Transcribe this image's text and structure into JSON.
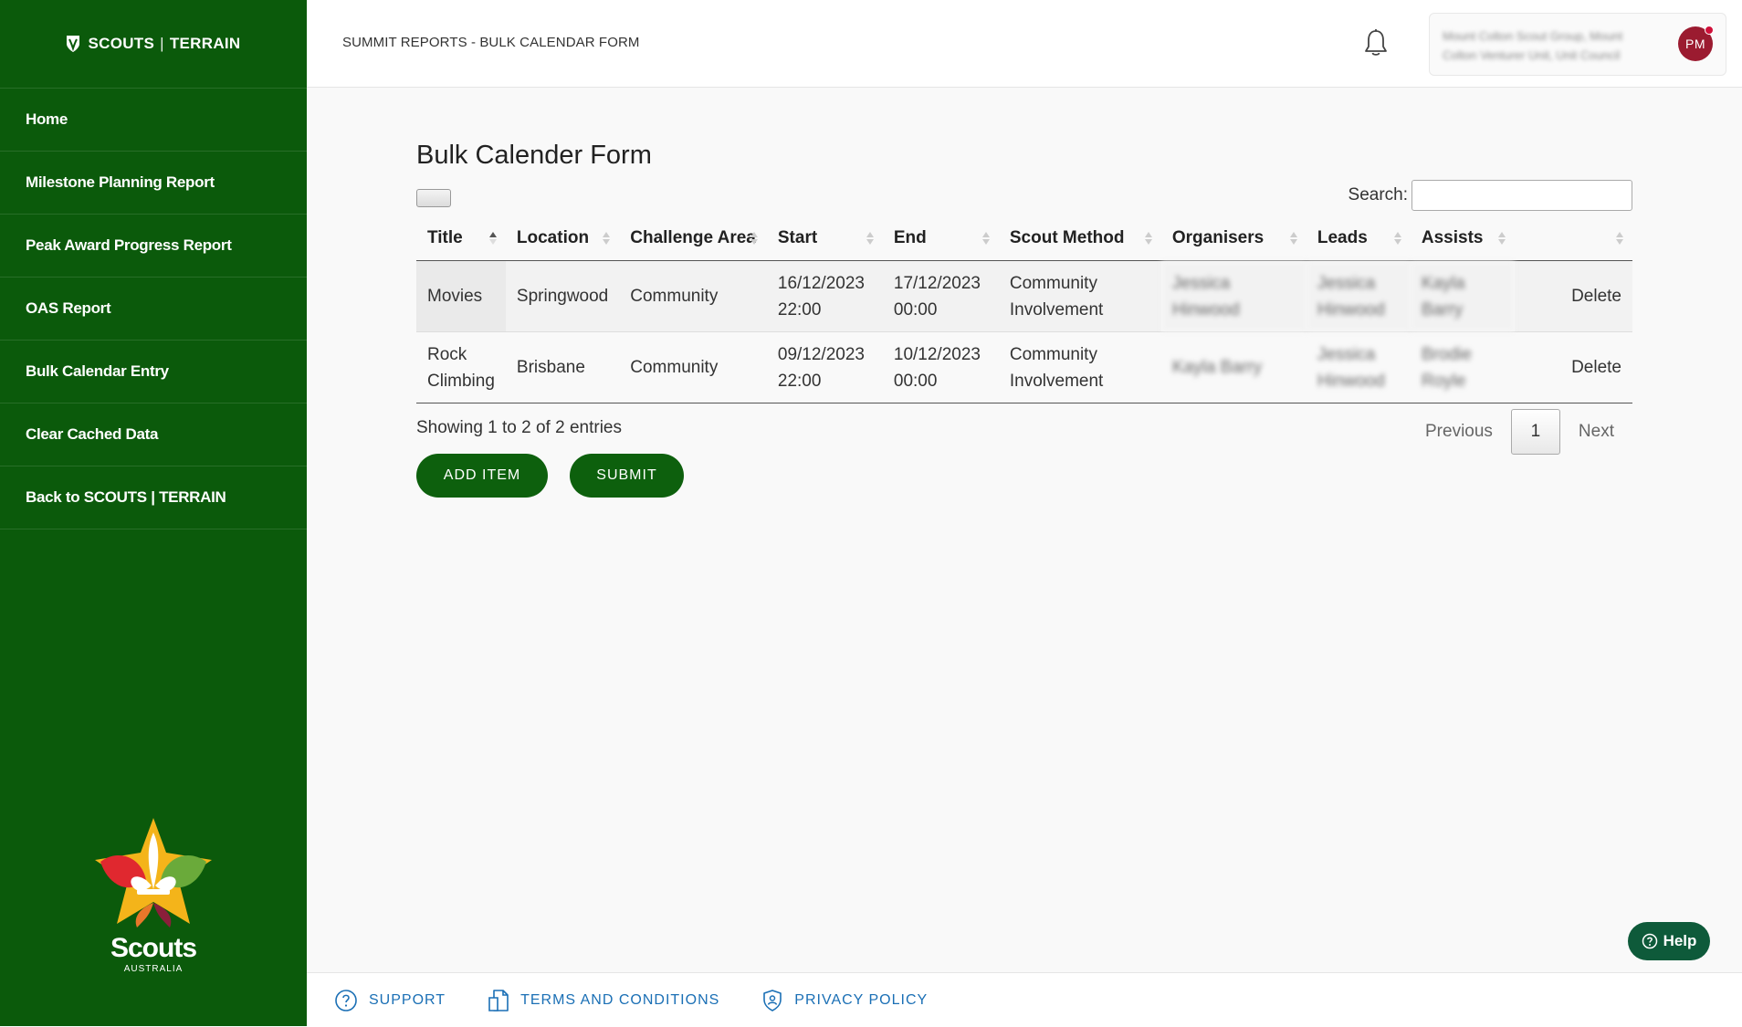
{
  "sidebar": {
    "brand_left": "SCOUTS",
    "brand_right": "TERRAIN",
    "items": [
      {
        "label": "Home"
      },
      {
        "label": "Milestone Planning Report"
      },
      {
        "label": "Peak Award Progress Report"
      },
      {
        "label": "OAS Report"
      },
      {
        "label": "Bulk Calendar Entry"
      },
      {
        "label": "Clear Cached Data"
      },
      {
        "label": "Back to SCOUTS | TERRAIN"
      }
    ],
    "logo_word": "Scouts",
    "logo_sub": "AUSTRALIA"
  },
  "header": {
    "breadcrumb": "SUMMIT REPORTS - BULK CALENDAR FORM",
    "user_text": "Mount Colton Scout Group, Mount Colton Venturer Unit, Unit Council",
    "avatar_initials": "PM"
  },
  "main": {
    "title": "Bulk Calender Form",
    "search_label": "Search:",
    "search_value": "",
    "columns": [
      "Title",
      "Location",
      "Challenge Area",
      "Start",
      "End",
      "Scout Method",
      "Organisers",
      "Leads",
      "Assists",
      ""
    ],
    "rows": [
      {
        "title": "Movies",
        "location": "Springwood",
        "challenge": "Community",
        "start": "16/12/2023 22:00",
        "end": "17/12/2023 00:00",
        "method": "Community Involvement",
        "organisers": "Jessica Hinwood",
        "leads": "Jessica Hinwood",
        "assists": "Kayla Barry",
        "action": "Delete"
      },
      {
        "title": "Rock Climbing",
        "location": "Brisbane",
        "challenge": "Community",
        "start": "09/12/2023 22:00",
        "end": "10/12/2023 00:00",
        "method": "Community Involvement",
        "organisers": "Kayla Barry",
        "leads": "Jessica Hinwood",
        "assists": "Brodie Royle",
        "action": "Delete"
      }
    ],
    "info": "Showing 1 to 2 of 2 entries",
    "pager": {
      "previous": "Previous",
      "page": "1",
      "next": "Next"
    },
    "add_item": "ADD ITEM",
    "submit": "SUBMIT"
  },
  "help_label": "Help",
  "footer": {
    "support": "SUPPORT",
    "terms": "TERMS AND CONDITIONS",
    "privacy": "PRIVACY POLICY"
  },
  "colors": {
    "sidebar": "#0b5a0b",
    "button": "#0d600d",
    "avatar": "#9b1b30",
    "link": "#1a6fb5"
  }
}
